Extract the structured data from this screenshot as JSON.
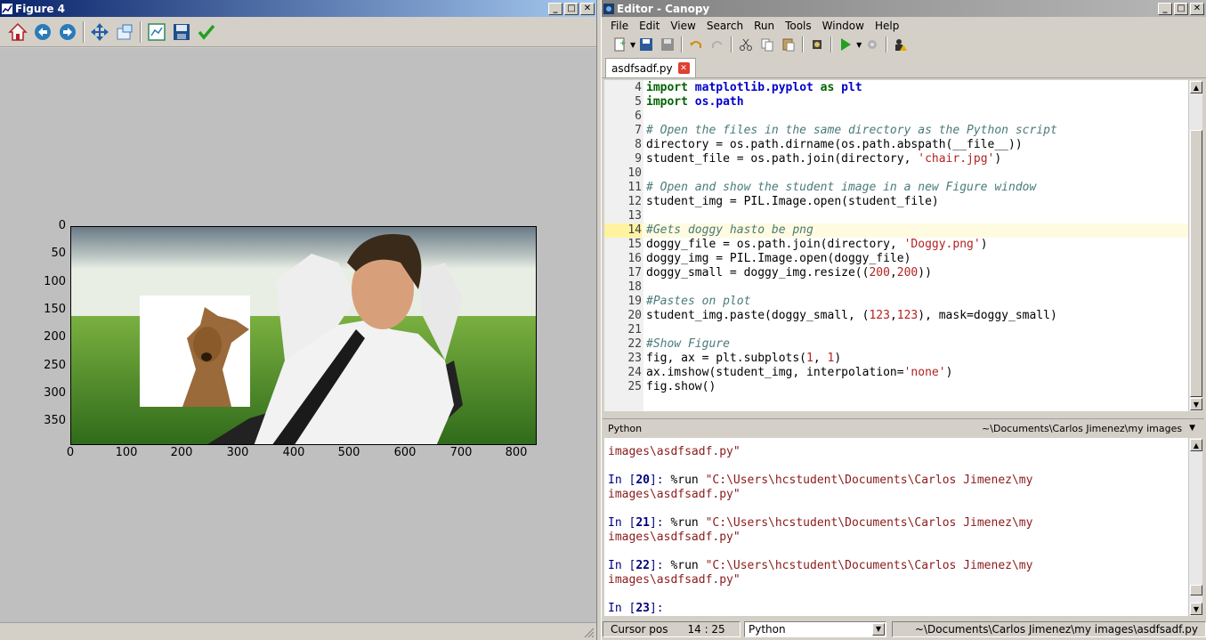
{
  "figure_window": {
    "title": "Figure 4",
    "toolbar_icons": [
      "home-icon",
      "back-icon",
      "forward-icon",
      "pan-icon",
      "zoom-icon",
      "subplots-icon",
      "save-icon",
      "check-icon"
    ],
    "y_ticks": [
      "0",
      "50",
      "100",
      "150",
      "200",
      "250",
      "300",
      "350"
    ],
    "x_ticks": [
      "0",
      "100",
      "200",
      "300",
      "400",
      "500",
      "600",
      "700",
      "800"
    ]
  },
  "editor_window": {
    "title": "Editor - Canopy",
    "menu": [
      "File",
      "Edit",
      "View",
      "Search",
      "Run",
      "Tools",
      "Window",
      "Help"
    ],
    "tab_label": "asdfsadf.py",
    "code_lines": [
      {
        "num": "4",
        "parts": [
          [
            "kw",
            "import "
          ],
          [
            "mod",
            "matplotlib.pyplot"
          ],
          [
            "kw",
            " as "
          ],
          [
            "mod",
            "plt"
          ]
        ]
      },
      {
        "num": "5",
        "parts": [
          [
            "kw",
            "import "
          ],
          [
            "mod",
            "os.path"
          ]
        ]
      },
      {
        "num": "6",
        "parts": []
      },
      {
        "num": "7",
        "parts": [
          [
            "com",
            "# Open the files in the same directory as the Python script"
          ]
        ]
      },
      {
        "num": "8",
        "parts": [
          [
            "",
            "directory = os.path.dirname(os.path.abspath(__file__))"
          ]
        ]
      },
      {
        "num": "9",
        "parts": [
          [
            "",
            "student_file = os.path.join(directory, "
          ],
          [
            "str",
            "'chair.jpg'"
          ],
          [
            "",
            ")"
          ]
        ]
      },
      {
        "num": "10",
        "parts": []
      },
      {
        "num": "11",
        "parts": [
          [
            "com",
            "# Open and show the student image in a new Figure window"
          ]
        ]
      },
      {
        "num": "12",
        "parts": [
          [
            "",
            "student_img = PIL.Image.open(student_file)"
          ]
        ]
      },
      {
        "num": "13",
        "parts": []
      },
      {
        "num": "14",
        "parts": [
          [
            "com",
            "#Gets doggy hasto be png"
          ]
        ],
        "highlight": true
      },
      {
        "num": "15",
        "parts": [
          [
            "",
            "doggy_file = os.path.join(directory, "
          ],
          [
            "str",
            "'Doggy.png'"
          ],
          [
            "",
            ")"
          ]
        ]
      },
      {
        "num": "16",
        "parts": [
          [
            "",
            "doggy_img = PIL.Image.open(doggy_file)"
          ]
        ]
      },
      {
        "num": "17",
        "parts": [
          [
            "",
            "doggy_small = doggy_img.resize(("
          ],
          [
            "str",
            "200"
          ],
          [
            "",
            ","
          ],
          [
            "str",
            "200"
          ],
          [
            "",
            "))"
          ]
        ]
      },
      {
        "num": "18",
        "parts": []
      },
      {
        "num": "19",
        "parts": [
          [
            "com",
            "#Pastes on plot"
          ]
        ]
      },
      {
        "num": "20",
        "parts": [
          [
            "",
            "student_img.paste(doggy_small, ("
          ],
          [
            "str",
            "123"
          ],
          [
            "",
            ","
          ],
          [
            "str",
            "123"
          ],
          [
            "",
            "), mask=doggy_small)"
          ]
        ]
      },
      {
        "num": "21",
        "parts": []
      },
      {
        "num": "22",
        "parts": [
          [
            "com",
            "#Show Figure"
          ]
        ]
      },
      {
        "num": "23",
        "parts": [
          [
            "",
            "fig, ax = plt.subplots("
          ],
          [
            "str",
            "1"
          ],
          [
            "",
            ", "
          ],
          [
            "str",
            "1"
          ],
          [
            "",
            ")"
          ]
        ]
      },
      {
        "num": "24",
        "parts": [
          [
            "",
            "ax.imshow(student_img, interpolation="
          ],
          [
            "str",
            "'none'"
          ],
          [
            "",
            ")"
          ]
        ]
      },
      {
        "num": "25",
        "parts": [
          [
            "",
            "fig.show()"
          ]
        ]
      }
    ],
    "python_pane_label": "Python",
    "python_pane_path": "~\\Documents\\Carlos Jimenez\\my images",
    "console_lines": [
      {
        "type": "cont",
        "text": "images\\asdfsadf.py\""
      },
      {
        "type": "blank"
      },
      {
        "type": "in",
        "num": "20",
        "cmd": "%run ",
        "path": "\"C:\\Users\\hcstudent\\Documents\\Carlos Jimenez\\my"
      },
      {
        "type": "cont",
        "text": "images\\asdfsadf.py\""
      },
      {
        "type": "blank"
      },
      {
        "type": "in",
        "num": "21",
        "cmd": "%run ",
        "path": "\"C:\\Users\\hcstudent\\Documents\\Carlos Jimenez\\my"
      },
      {
        "type": "cont",
        "text": "images\\asdfsadf.py\""
      },
      {
        "type": "blank"
      },
      {
        "type": "in",
        "num": "22",
        "cmd": "%run ",
        "path": "\"C:\\Users\\hcstudent\\Documents\\Carlos Jimenez\\my"
      },
      {
        "type": "cont",
        "text": "images\\asdfsadf.py\""
      },
      {
        "type": "blank"
      },
      {
        "type": "in",
        "num": "23",
        "cmd": "",
        "path": ""
      }
    ],
    "status": {
      "cursor_label": "Cursor pos",
      "cursor_value": "14 : 25",
      "language": "Python",
      "file_path": "~\\Documents\\Carlos Jimenez\\my images\\asdfsadf.py"
    }
  },
  "colors": {
    "titlebar_start": "#0a246a",
    "titlebar_end": "#a6caf0",
    "comment": "#4a7a7a",
    "string": "#b22222",
    "keyword": "#006400"
  }
}
